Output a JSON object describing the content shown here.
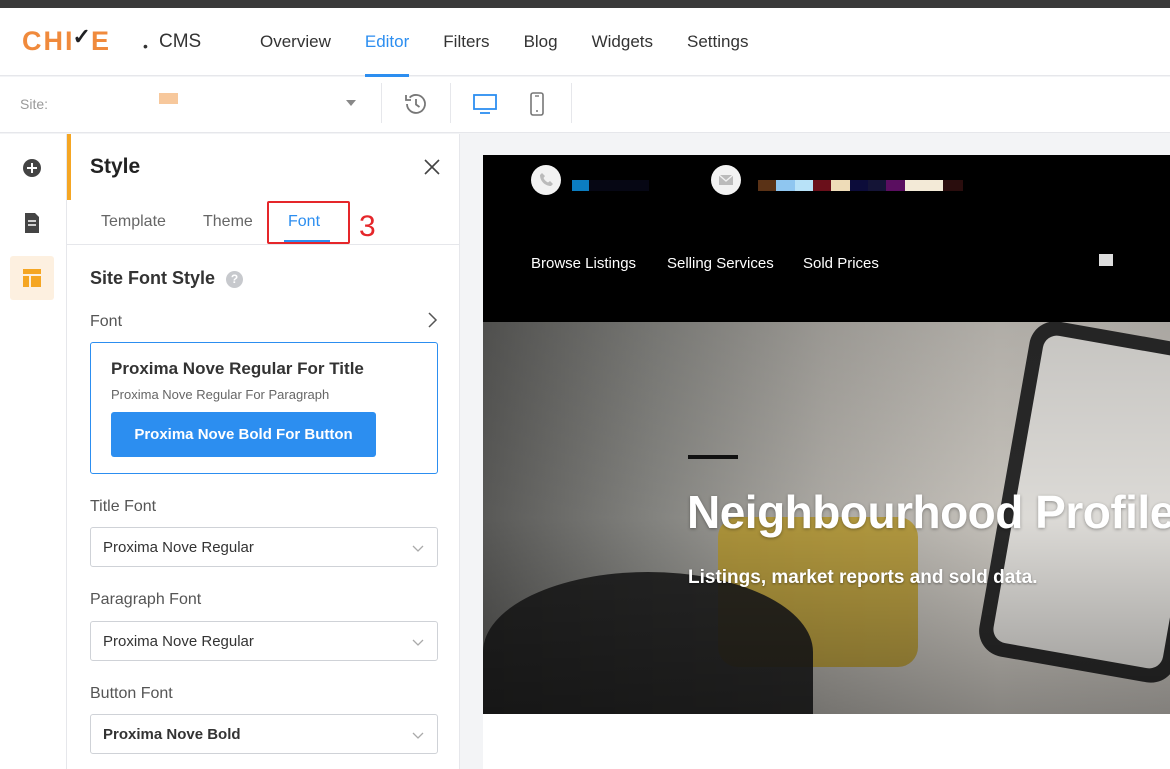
{
  "header": {
    "logo_text": "CHIME",
    "separator": "•",
    "product": "CMS",
    "nav": [
      {
        "label": "Overview",
        "active": false
      },
      {
        "label": "Editor",
        "active": true
      },
      {
        "label": "Filters",
        "active": false
      },
      {
        "label": "Blog",
        "active": false
      },
      {
        "label": "Widgets",
        "active": false
      },
      {
        "label": "Settings",
        "active": false
      }
    ]
  },
  "toolbar": {
    "site_label": "Site:",
    "icons": [
      "history-icon",
      "desktop-icon",
      "mobile-icon"
    ]
  },
  "rail": {
    "items": [
      "add-icon",
      "page-icon",
      "layout-icon"
    ]
  },
  "panel": {
    "title": "Style",
    "tabs": [
      {
        "label": "Template",
        "active": false
      },
      {
        "label": "Theme",
        "active": false
      },
      {
        "label": "Font",
        "active": true
      }
    ],
    "annotation_number": "3",
    "section_title": "Site Font Style",
    "help_glyph": "?",
    "font_label": "Font",
    "preview": {
      "title": "Proxima Nove Regular For Title",
      "paragraph": "Proxima Nove Regular For Paragraph",
      "button": "Proxima Nove Bold For Button"
    },
    "title_font": {
      "label": "Title Font",
      "value": "Proxima Nove Regular"
    },
    "paragraph_font": {
      "label": "Paragraph Font",
      "value": "Proxima Nove Regular"
    },
    "button_font": {
      "label": "Button Font",
      "value": "Proxima Nove Bold"
    }
  },
  "site_preview": {
    "nav": [
      "Browse Listings",
      "Selling Services",
      "Sold Prices"
    ],
    "hero_title": "Neighbourhood Profiles",
    "hero_subtitle": "Listings, market reports and sold data."
  },
  "colors": {
    "accent_blue": "#2c8ef0",
    "brand_orange": "#f08a3c",
    "annotation_red": "#e5262a",
    "panel_accent": "#f5a623"
  }
}
